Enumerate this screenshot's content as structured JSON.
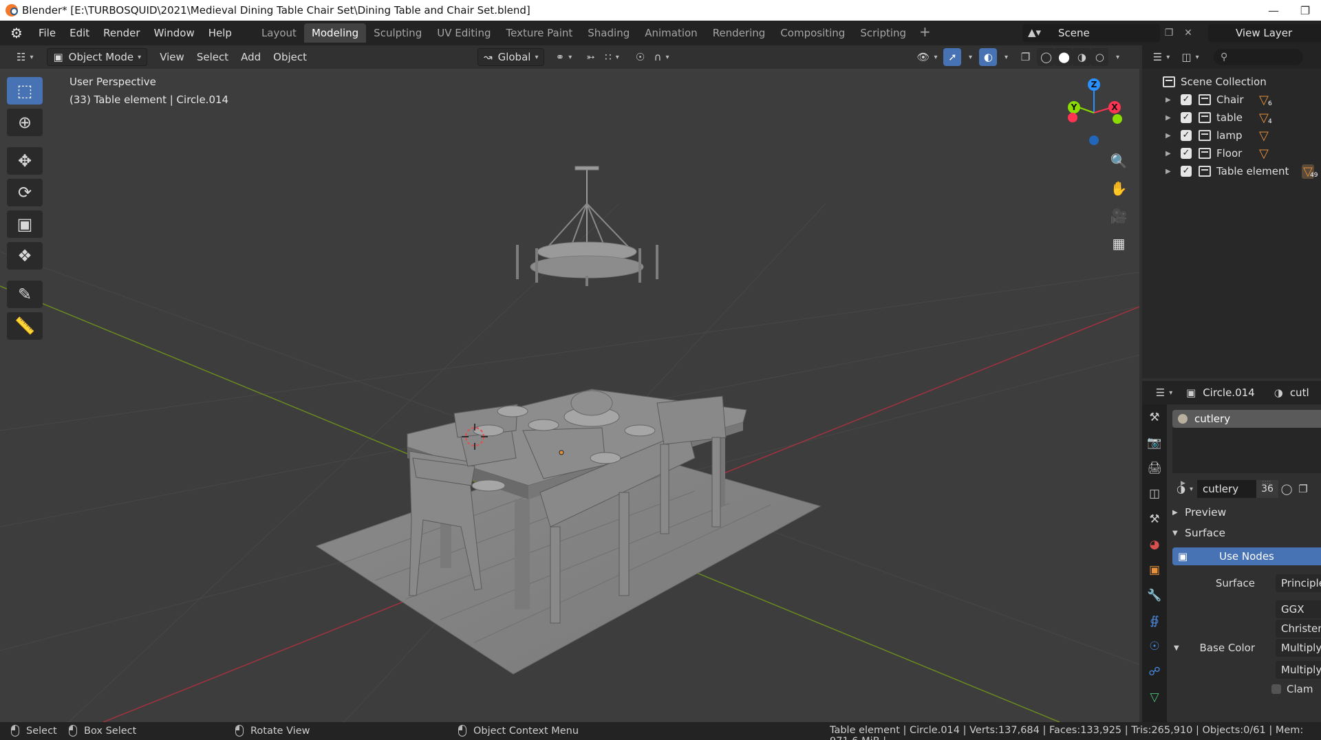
{
  "window": {
    "title": "Blender* [E:\\TURBOSQUID\\2021\\Medieval Dining Table Chair Set\\Dining Table and Chair Set.blend]"
  },
  "menu": {
    "items": [
      "File",
      "Edit",
      "Render",
      "Window",
      "Help"
    ]
  },
  "workspaces": {
    "tabs": [
      "Layout",
      "Modeling",
      "Sculpting",
      "UV Editing",
      "Texture Paint",
      "Shading",
      "Animation",
      "Rendering",
      "Compositing",
      "Scripting"
    ],
    "active": "Modeling"
  },
  "scene": {
    "name": "Scene"
  },
  "view_layer": {
    "name": "View Layer"
  },
  "viewport_header": {
    "mode": "Object Mode",
    "menus": [
      "View",
      "Select",
      "Add",
      "Object"
    ],
    "transform_orientation": "Global"
  },
  "viewport": {
    "perspective_label": "User Perspective",
    "object_label": "(33) Table element | Circle.014",
    "axes": {
      "x": "X",
      "y": "Y",
      "z": "Z"
    }
  },
  "outliner": {
    "root": "Scene Collection",
    "collections": [
      {
        "name": "Chair",
        "count": "6"
      },
      {
        "name": "table",
        "count": "4"
      },
      {
        "name": "lamp",
        "count": ""
      },
      {
        "name": "Floor",
        "count": ""
      },
      {
        "name": "Table element",
        "count": "49"
      }
    ]
  },
  "properties": {
    "object_name": "Circle.014",
    "material_short": "cutl",
    "slot_material": "cutlery",
    "material_name": "cutlery",
    "material_users": "36",
    "sections": {
      "preview": "Preview",
      "surface": "Surface"
    },
    "use_nodes_label": "Use Nodes",
    "surface_label": "Surface",
    "surface_value": "Principle",
    "distribution": "GGX",
    "subsurface_method": "Christen",
    "base_color_label": "Base Color",
    "base_color_value": "Multiply",
    "base_color_value2": "Multiply",
    "clamp_label": "Clam"
  },
  "statusbar": {
    "select": "Select",
    "box_select": "Box Select",
    "rotate_view": "Rotate View",
    "context_menu": "Object Context Menu",
    "stats": "Table element | Circle.014 | Verts:137,684 | Faces:133,925 | Tris:265,910 | Objects:0/61 | Mem: 971.6 MiB |"
  },
  "colors": {
    "accent_blue": "#4772b3",
    "axis_x": "#ff3352",
    "axis_y": "#8bdc00",
    "axis_z": "#2890ff",
    "mesh_orange": "#e8903a",
    "viewport_bg": "#3d3d3d"
  }
}
